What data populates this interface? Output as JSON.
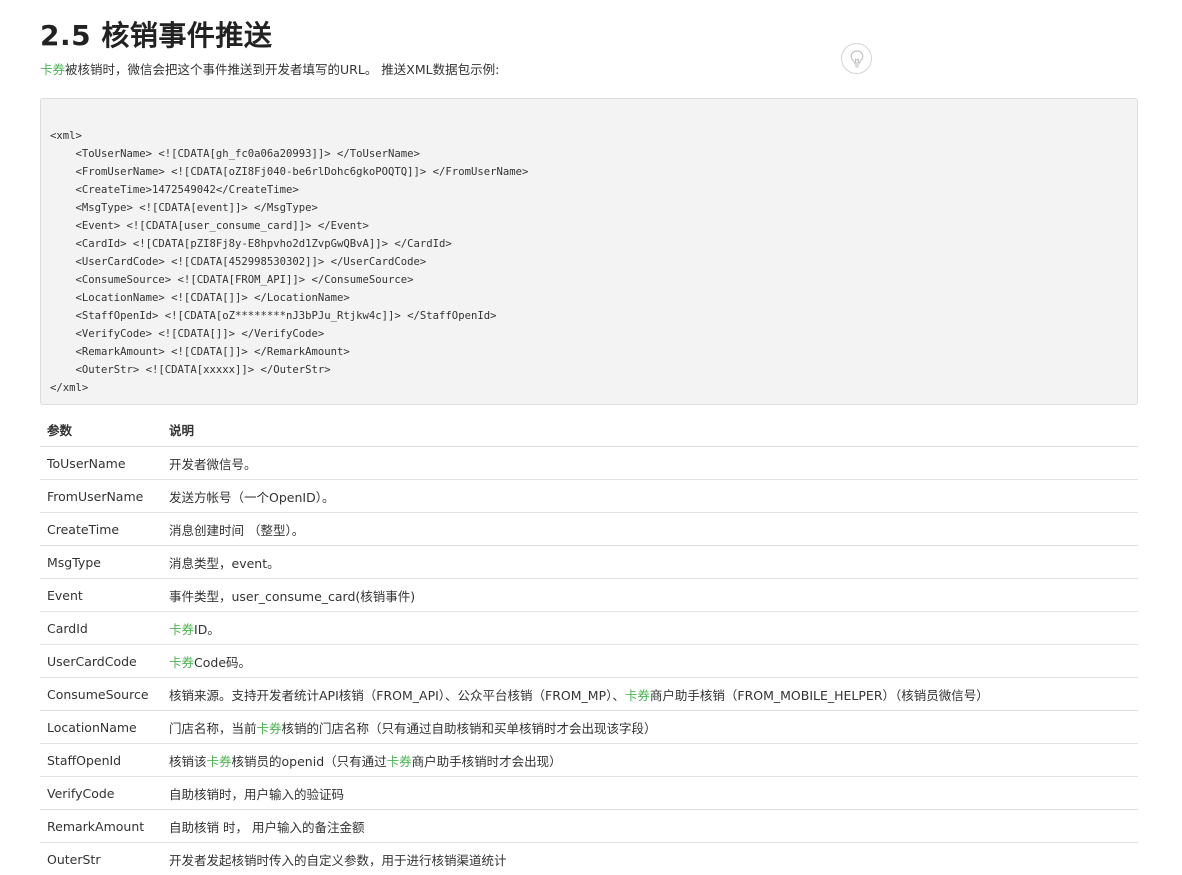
{
  "section": {
    "title": "2.5 核销事件推送",
    "intro_link": "卡券",
    "intro_text": "被核销时，微信会把这个事件推送到开发者填写的URL。 推送XML数据包示例:"
  },
  "code_example": "<xml>\n    <ToUserName> <![CDATA[gh_fc0a06a20993]]> </ToUserName>\n    <FromUserName> <![CDATA[oZI8Fj040-be6rlDohc6gkoPOQTQ]]> </FromUserName>\n    <CreateTime>1472549042</CreateTime>\n    <MsgType> <![CDATA[event]]> </MsgType>\n    <Event> <![CDATA[user_consume_card]]> </Event>\n    <CardId> <![CDATA[pZI8Fj8y-E8hpvho2d1ZvpGwQBvA]]> </CardId>\n    <UserCardCode> <![CDATA[452998530302]]> </UserCardCode>\n    <ConsumeSource> <![CDATA[FROM_API]]> </ConsumeSource>\n    <LocationName> <![CDATA[]]> </LocationName>\n    <StaffOpenId> <![CDATA[oZ********nJ3bPJu_Rtjkw4c]]> </StaffOpenId>\n    <VerifyCode> <![CDATA[]]> </VerifyCode>\n    <RemarkAmount> <![CDATA[]]> </RemarkAmount>\n    <OuterStr> <![CDATA[xxxxx]]> </OuterStr>\n</xml>",
  "table": {
    "headers": [
      "参数",
      "说明"
    ],
    "rows": [
      {
        "param": "ToUserName",
        "desc": [
          {
            "t": "开发者微信号。"
          }
        ]
      },
      {
        "param": "FromUserName",
        "desc": [
          {
            "t": "发送方帐号（一个OpenID）。"
          }
        ]
      },
      {
        "param": "CreateTime",
        "desc": [
          {
            "t": "消息创建时间 （整型）。"
          }
        ]
      },
      {
        "param": "MsgType",
        "desc": [
          {
            "t": "消息类型，event。"
          }
        ]
      },
      {
        "param": "Event",
        "desc": [
          {
            "t": "事件类型，user_consume_card(核销事件)"
          }
        ]
      },
      {
        "param": "CardId",
        "desc": [
          {
            "t": "卡券",
            "link": true
          },
          {
            "t": "ID。"
          }
        ]
      },
      {
        "param": "UserCardCode",
        "desc": [
          {
            "t": "卡券",
            "link": true
          },
          {
            "t": "Code码。"
          }
        ]
      },
      {
        "param": "ConsumeSource",
        "desc": [
          {
            "t": "核销来源。支持开发者统计API核销（FROM_API）、公众平台核销（FROM_MP）、"
          },
          {
            "t": "卡券",
            "link": true
          },
          {
            "t": "商户助手核销（FROM_MOBILE_HELPER）（核销员微信号）"
          }
        ]
      },
      {
        "param": "LocationName",
        "desc": [
          {
            "t": "门店名称，当前"
          },
          {
            "t": "卡券",
            "link": true
          },
          {
            "t": "核销的门店名称（只有通过自助核销和买单核销时才会出现该字段）"
          }
        ]
      },
      {
        "param": "StaffOpenId",
        "desc": [
          {
            "t": "核销该"
          },
          {
            "t": "卡券",
            "link": true
          },
          {
            "t": "核销员的openid（只有通过"
          },
          {
            "t": "卡券",
            "link": true
          },
          {
            "t": "商户助手核销时才会出现）"
          }
        ]
      },
      {
        "param": "VerifyCode",
        "desc": [
          {
            "t": "自助核销时，用户输入的验证码"
          }
        ]
      },
      {
        "param": "RemarkAmount",
        "desc": [
          {
            "t": "自助核销 时， 用户输入的备注金额"
          }
        ]
      },
      {
        "param": "OuterStr",
        "desc": [
          {
            "t": "开发者发起核销时传入的自定义参数，用于进行核销渠道统计"
          }
        ]
      }
    ]
  },
  "colors": {
    "link": "#4bb450",
    "code_bg": "#f3f3f3"
  },
  "icons": {
    "tip": "lightbulb-icon"
  }
}
